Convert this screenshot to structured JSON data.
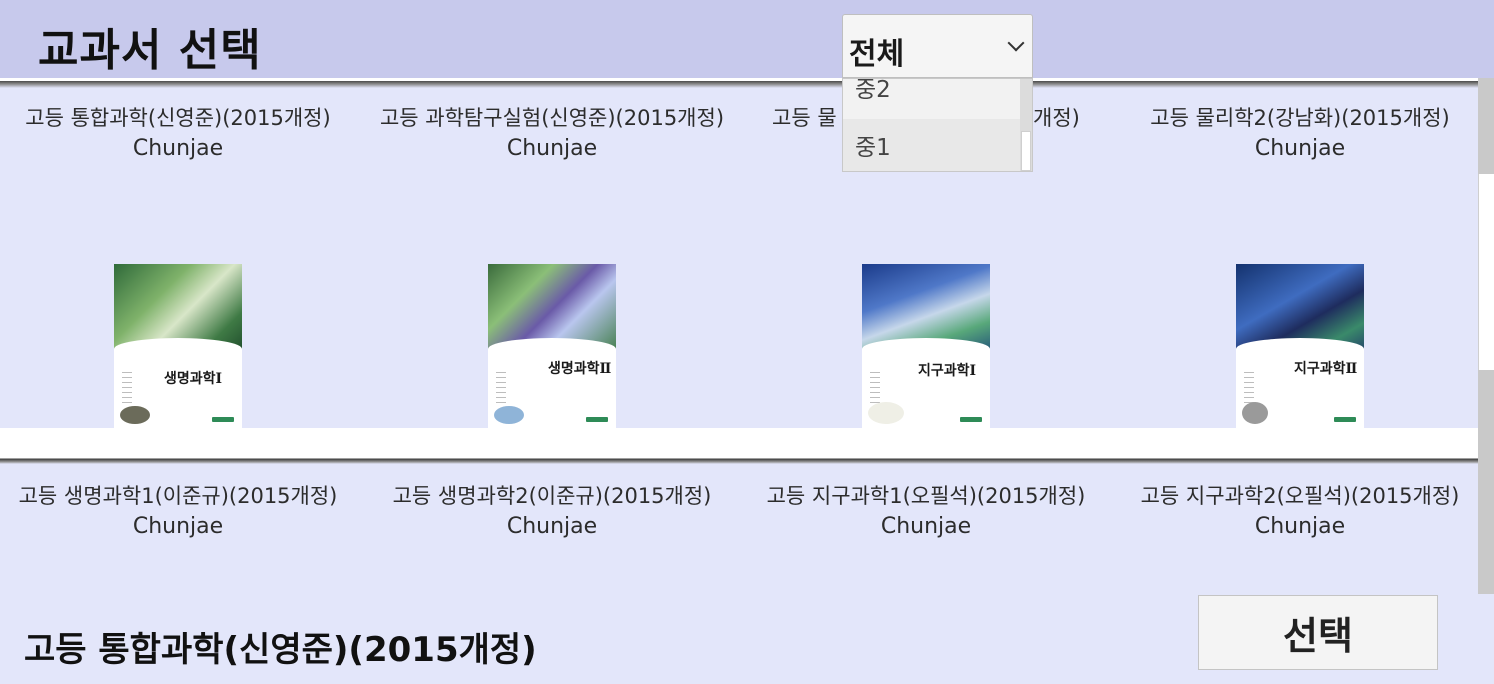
{
  "header": {
    "title": "교과서 선택"
  },
  "filter": {
    "selected": "전체",
    "options_visible": [
      "중2",
      "중1"
    ]
  },
  "books_row1": [
    {
      "title": "고등 통합과학(신영준)(2015개정)",
      "publisher": "Chunjae"
    },
    {
      "title": "고등 과학탐구실험(신영준)(2015개정)",
      "publisher": "Chunjae"
    },
    {
      "title": "고등 물",
      "title_end": "개정)",
      "publisher": "Chunjae"
    },
    {
      "title": "고등 물리학2(강남화)(2015개정)",
      "publisher": "Chunjae"
    }
  ],
  "books_row2": [
    {
      "cover_title": "생명과학Ⅰ",
      "title": "고등 생명과학1(이준규)(2015개정)",
      "publisher": "Chunjae",
      "art": "art-a"
    },
    {
      "cover_title": "생명과학Ⅱ",
      "title": "고등 생명과학2(이준규)(2015개정)",
      "publisher": "Chunjae",
      "art": "art-b"
    },
    {
      "cover_title": "지구과학Ⅰ",
      "title": "고등 지구과학1(오필석)(2015개정)",
      "publisher": "Chunjae",
      "art": "art-c"
    },
    {
      "cover_title": "지구과학Ⅱ",
      "title": "고등 지구과학2(오필석)(2015개정)",
      "publisher": "Chunjae",
      "art": "art-d"
    }
  ],
  "footer": {
    "selected_book": "고등 통합과학(신영준)(2015개정)",
    "select_button": "선택"
  },
  "colors": {
    "header_bg": "#c7c9ec",
    "page_bg": "#e3e6fa"
  }
}
